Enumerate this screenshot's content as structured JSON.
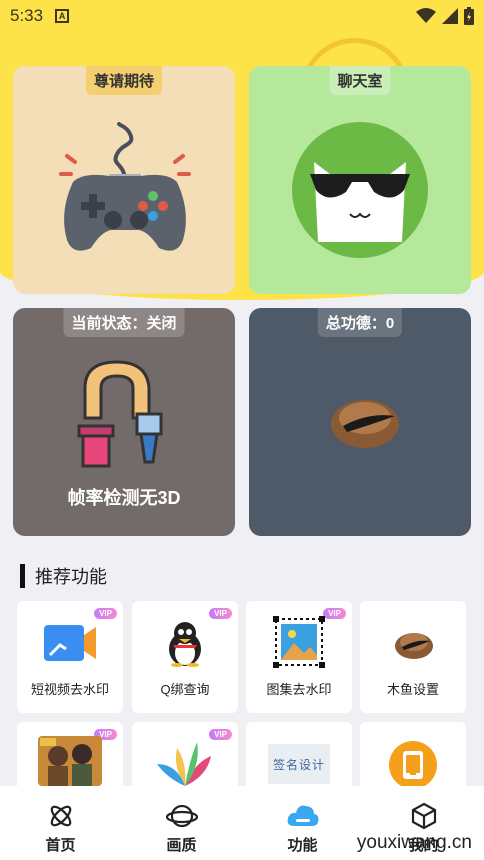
{
  "status_bar": {
    "time": "5:33",
    "notification_icon_letter": "A"
  },
  "cards": {
    "game": {
      "tag": "尊请期待"
    },
    "chat": {
      "tag": "聊天室"
    },
    "frame_rate": {
      "tag": "当前状态：关闭",
      "caption": "帧率检测无3D"
    },
    "merit": {
      "tag": "总功德：0"
    }
  },
  "section": {
    "title": "推荐功能"
  },
  "features": [
    {
      "label": "短视频去水印",
      "badge": "VIP",
      "icon": "video-camera-icon"
    },
    {
      "label": "Q绑查询",
      "badge": "VIP",
      "icon": "penguin-icon"
    },
    {
      "label": "图集去水印",
      "badge": "VIP",
      "icon": "image-icon"
    },
    {
      "label": "木鱼设置",
      "badge": "",
      "icon": "wooden-fish-icon"
    },
    {
      "label": "",
      "badge": "VIP",
      "icon": "game-characters-icon"
    },
    {
      "label": "",
      "badge": "VIP",
      "icon": "petals-icon"
    },
    {
      "label": "",
      "badge": "",
      "icon": "signature-design-icon"
    },
    {
      "label": "",
      "badge": "",
      "icon": "orange-phone-icon"
    }
  ],
  "signature_image_text": "签名设计",
  "bottom_nav": [
    {
      "label": "首页",
      "icon": "atom-icon"
    },
    {
      "label": "画质",
      "icon": "planet-icon"
    },
    {
      "label": "功能",
      "icon": "cloud-icon"
    },
    {
      "label": "我的",
      "icon": "cube-icon"
    }
  ],
  "watermark": "youxiwang.cn",
  "colors": {
    "accent_yellow": "#fde24a",
    "nav_active_blue": "#3aa8f0"
  }
}
